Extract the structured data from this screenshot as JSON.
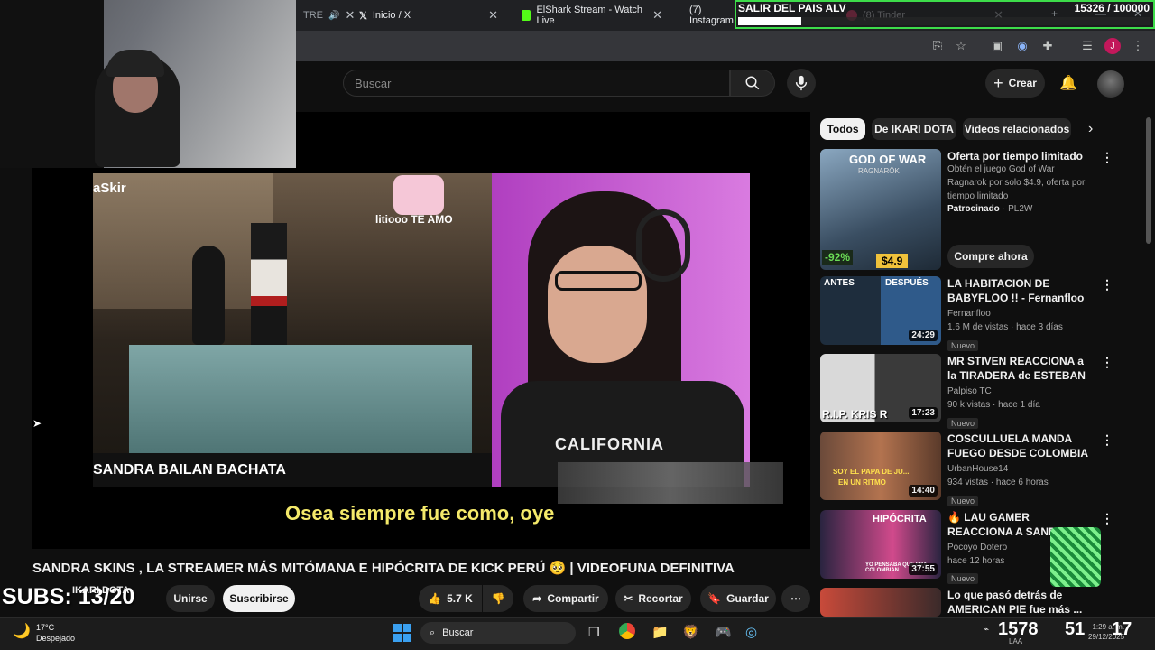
{
  "browser": {
    "tabs": [
      {
        "label": "TRE",
        "name": "tab-partial"
      },
      {
        "label": "Inicio / X",
        "name": "tab-x"
      },
      {
        "label": "ElShark Stream - Watch Live",
        "name": "tab-kick"
      },
      {
        "label": "(7) Instagram",
        "name": "tab-instagram"
      },
      {
        "label": "(8) Tinder",
        "name": "tab-tinder"
      }
    ]
  },
  "overlay": {
    "goal_title": "SALIR DEL PAIS ALV",
    "goal_progress": "15326 / 100000",
    "goal_fraction": 0.153,
    "subs_label": "SUBS: 13/20",
    "taskbar_numbers": "1578",
    "taskbar_numbers2": "51",
    "taskbar_numbers3": "17"
  },
  "youtube": {
    "search_placeholder": "Buscar",
    "create_label": "Crear",
    "video": {
      "title": "SANDRA SKINS , LA STREAMER MÁS MITÓMANA E HIPÓCRITA DE KICK PERÚ 🥺 | VIDEOFUNA DEFINITIVA",
      "channel": "IKARI DOTA",
      "join_label": "Unirse",
      "subscribe_label": "Suscribirse",
      "likes": "5.7 K",
      "share_label": "Compartir",
      "clip_label": "Recortar",
      "save_label": "Guardar",
      "caption": "Osea siempre fue como, oye",
      "lower_third": "SANDRA BAILAN BACHATA",
      "sticker_text": "litiooo TE AMO",
      "streamer_label": "aSkir",
      "shirt_text": "CALIFORNIA"
    },
    "chips": [
      "Todos",
      "De IKARI DOTA",
      "Videos relacionados"
    ],
    "sidebar": [
      {
        "title": "Oferta por tiempo limitado",
        "desc": "Obtén el juego God of War Ragnarok por solo $4.9, oferta por tiempo limitado",
        "sponsor": "Patrocinado",
        "advertiser": "PL2W",
        "cta": "Compre ahora",
        "thumb_brand": "GOD OF WAR",
        "thumb_sub": "RAGNARÖK",
        "discount": "-92%",
        "price": "$4.9"
      },
      {
        "title": "LA HABITACION DE BABYFLOO !! - Fernanfloo",
        "channel": "Fernanfloo",
        "meta": "1.6 M de vistas · hace 3 días",
        "badge": "Nuevo",
        "duration": "24:29",
        "thumb_text1": "ANTES",
        "thumb_text2": "DESPUÉS"
      },
      {
        "title": "MR STIVEN REACCIONA a la TIRADERA de ESTEBAN ROJA...",
        "channel": "Palpiso TC",
        "meta": "90 k vistas · hace 1 día",
        "badge": "Nuevo",
        "duration": "17:23",
        "thumb_text1": "R.I.P. KRIS R"
      },
      {
        "title": "COSCULLUELA MANDA FUEGO DESDE COLOMBIA 🇨🇴 PIRLO Y...",
        "channel": "UrbanHouse14",
        "meta": "934 vistas · hace 6 horas",
        "badge": "Nuevo",
        "duration": "14:40",
        "thumb_text1": "SOY EL PAPA DE JU...",
        "thumb_text2": "EN UN RITMO"
      },
      {
        "title": "🔥 LAU GAMER REACCIONA A SANDRA SKINS LA STREAME...",
        "channel": "Pocoyo Dotero",
        "meta": "hace 12 horas",
        "badge": "Nuevo",
        "duration": "37:55",
        "thumb_text1": "HIPÓCRITA",
        "thumb_text2": "YO PENSABA QUE ERA COLOMBIAN"
      },
      {
        "title": "Lo que pasó detrás de AMERICAN PIE fue más ...",
        "channel": "",
        "meta": "",
        "badge": "",
        "duration": ""
      }
    ]
  },
  "taskbar": {
    "weather_temp": "17°C",
    "weather_desc": "Despejado",
    "search_label": "Buscar",
    "time": "1:29 a. m.",
    "date": "29/12/2025",
    "lang": "LAA"
  },
  "colors": {
    "accent_red": "#ff0000",
    "goal_green": "#3ddc4a",
    "brand_kick": "#53fc18"
  }
}
